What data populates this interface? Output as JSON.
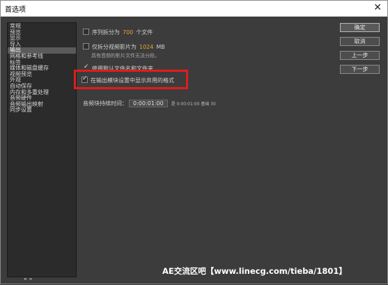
{
  "window": {
    "title": "首选项",
    "close_glyph": "✕"
  },
  "nav": {
    "items": [
      {
        "label": "常规",
        "active": false
      },
      {
        "label": "预览",
        "active": false
      },
      {
        "label": "显示",
        "active": false
      },
      {
        "label": "导入",
        "active": false
      },
      {
        "label": "输出",
        "active": true
      },
      {
        "label": "网格和参考线",
        "active": false
      },
      {
        "label": "标签",
        "active": false
      },
      {
        "label": "媒体和磁盘缓存",
        "active": false
      },
      {
        "label": "视频预览",
        "active": false
      },
      {
        "label": "外观",
        "active": false
      },
      {
        "label": "自动保存",
        "active": false
      },
      {
        "label": "内存和多重处理",
        "active": false
      },
      {
        "label": "音频硬件",
        "active": false
      },
      {
        "label": "音频输出映射",
        "active": false
      },
      {
        "label": "同步设置",
        "active": false
      }
    ],
    "logo_mark": "\" \""
  },
  "output": {
    "sequence_split": {
      "label_pre": "序列拆分为",
      "value": "700",
      "label_post": "个文件",
      "checked": false
    },
    "video_split": {
      "label_pre": "仅拆分视频影片为",
      "value": "1024",
      "label_post": "MB",
      "checked": false,
      "note": "具有音频的影片文件无法分段。"
    },
    "default_filename": {
      "label": "使用默认文件名和文件夹",
      "checked": true
    },
    "show_deprecated": {
      "label": "在输出模块设置中显示弃用的格式",
      "checked": true
    },
    "audio_block": {
      "label": "音频块持续时间：",
      "value": "0:00:01:00",
      "note": "是 0:00:01:00  基础 30"
    }
  },
  "buttons": {
    "ok": "确定",
    "cancel": "取消",
    "prev": "上一步",
    "next": "下一步"
  },
  "watermark": "AE交流区吧【www.linecg.com/tieba/1801】",
  "colors": {
    "accent_number": "#e8a33a",
    "highlight_box": "#e21c1c",
    "dialog_bg": "#3c3c3c"
  }
}
